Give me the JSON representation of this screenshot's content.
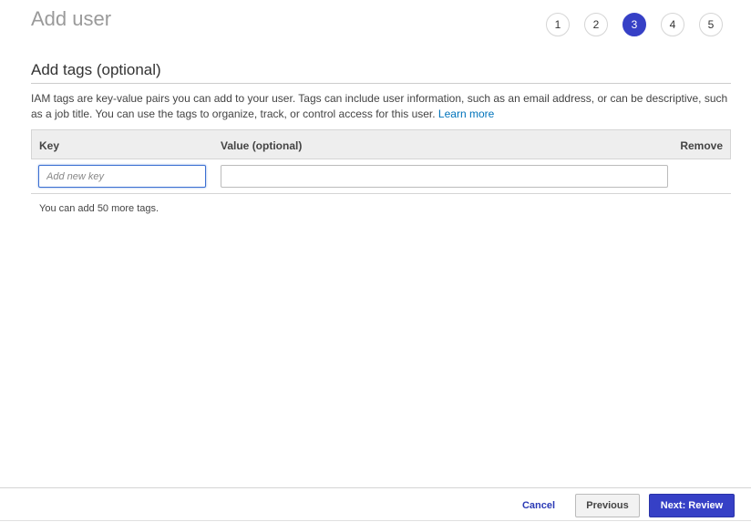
{
  "header": {
    "title": "Add user",
    "steps": [
      "1",
      "2",
      "3",
      "4",
      "5"
    ],
    "active_step": "3",
    "accent_color": "#3640c6"
  },
  "section": {
    "title": "Add tags (optional)",
    "description": "IAM tags are key-value pairs you can add to your user. Tags can include user information, such as an email address, or can be descriptive, such as a job title. You can use the tags to organize, track, or control access for this user.",
    "learn_more": "Learn more"
  },
  "table": {
    "columns": {
      "key": "Key",
      "value": "Value (optional)",
      "remove": "Remove"
    },
    "new_row": {
      "key_value": "",
      "key_placeholder": "Add new key",
      "value_value": ""
    }
  },
  "tags_remaining": "You can add 50 more tags.",
  "footer": {
    "cancel_label": "Cancel",
    "previous_label": "Previous",
    "next_label": "Next: Review"
  }
}
